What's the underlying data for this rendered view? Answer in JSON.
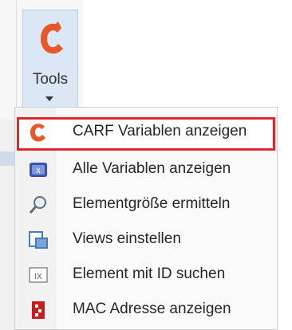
{
  "toolbar": {
    "tools_label": "Tools",
    "tools_icon": "carf-logo-icon",
    "dropdown_icon": "chevron-down-icon"
  },
  "menu": {
    "items": [
      {
        "label": "CARF Variablen anzeigen",
        "icon": "carf-logo-icon",
        "highlighted": true
      },
      {
        "label": "Alle Variablen anzeigen",
        "icon": "variables-icon",
        "highlighted": false
      },
      {
        "label": "Elementgröße ermitteln",
        "icon": "magnifier-icon",
        "highlighted": false
      },
      {
        "label": "Views einstellen",
        "icon": "views-icon",
        "highlighted": false
      },
      {
        "label": "Element mit ID suchen",
        "icon": "find-id-icon",
        "highlighted": false
      },
      {
        "label": "MAC Adresse anzeigen",
        "icon": "mac-address-icon",
        "highlighted": false
      }
    ]
  },
  "colors": {
    "brand": "#e8572a",
    "highlight_border": "#e0262e",
    "pressed_button": "#dbe7f5"
  }
}
